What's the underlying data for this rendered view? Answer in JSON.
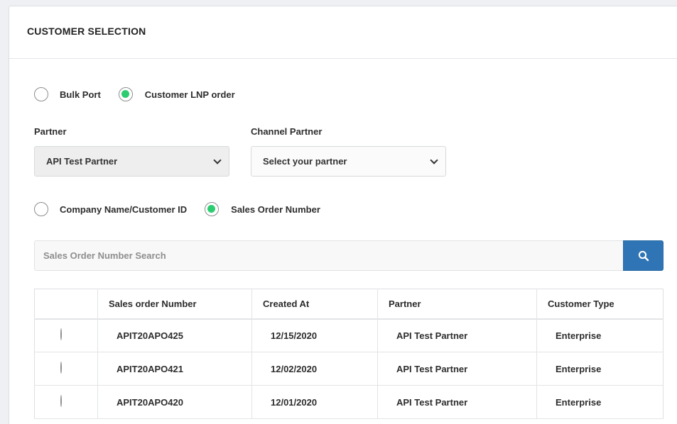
{
  "header": {
    "title": "CUSTOMER SELECTION"
  },
  "order_type": {
    "options": [
      {
        "label": "Bulk Port",
        "checked": false
      },
      {
        "label": "Customer LNP order",
        "checked": true
      }
    ]
  },
  "partner": {
    "label": "Partner",
    "value": "API Test Partner"
  },
  "channel_partner": {
    "label": "Channel Partner",
    "value": "Select your partner"
  },
  "search_by": {
    "options": [
      {
        "label": "Company Name/Customer ID",
        "checked": false
      },
      {
        "label": "Sales Order Number",
        "checked": true
      }
    ]
  },
  "search": {
    "placeholder": "Sales Order Number Search",
    "button_icon": "search-icon"
  },
  "table": {
    "columns": [
      "",
      "Sales order Number",
      "Created At",
      "Partner",
      "Customer Type"
    ],
    "rows": [
      {
        "selected": false,
        "sales_order": "APIT20APO425",
        "created_at": "12/15/2020",
        "partner": "API Test Partner",
        "customer_type": "Enterprise"
      },
      {
        "selected": false,
        "sales_order": "APIT20APO421",
        "created_at": "12/02/2020",
        "partner": "API Test Partner",
        "customer_type": "Enterprise"
      },
      {
        "selected": false,
        "sales_order": "APIT20APO420",
        "created_at": "12/01/2020",
        "partner": "API Test Partner",
        "customer_type": "Enterprise"
      }
    ]
  },
  "colors": {
    "accent": "#2f74b5",
    "radio_checked": "#2ecc71"
  }
}
